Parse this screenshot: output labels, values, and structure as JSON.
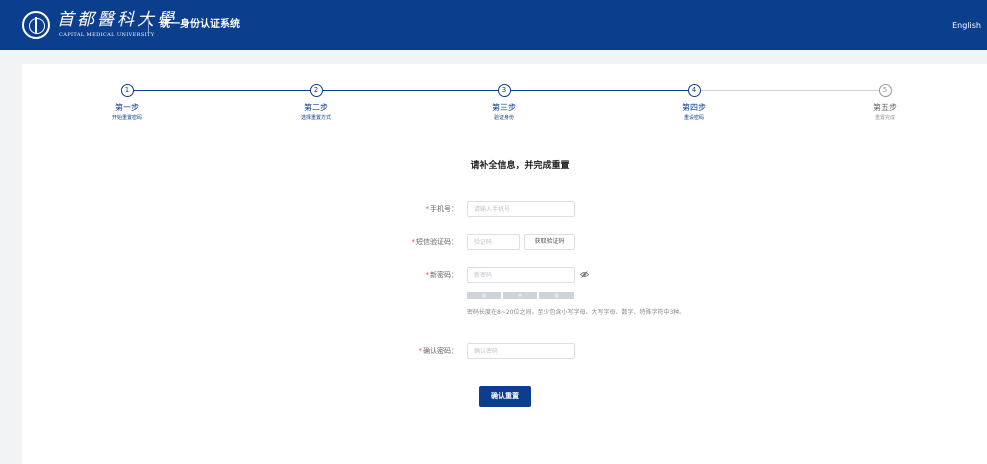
{
  "header": {
    "logo_cn": "首都醫科大學",
    "logo_en": "CAPITAL MEDICAL UNIVERSITY",
    "system_title": "统一身份认证系统",
    "language_link": "English"
  },
  "steps": [
    {
      "number": "1",
      "title": "第一步",
      "desc": "开始重置密码",
      "state": "done"
    },
    {
      "number": "2",
      "title": "第二步",
      "desc": "选择重置方式",
      "state": "done"
    },
    {
      "number": "3",
      "title": "第三步",
      "desc": "验证身份",
      "state": "done"
    },
    {
      "number": "4",
      "title": "第四步",
      "desc": "重设密码",
      "state": "current"
    },
    {
      "number": "5",
      "title": "第五步",
      "desc": "重置完成",
      "state": "todo"
    }
  ],
  "form": {
    "heading": "请补全信息，并完成重置",
    "required_mark": "*",
    "phone_label": "手机号：",
    "phone_placeholder": "请输入手机号",
    "sms_label": "短信验证码：",
    "sms_placeholder": "验证码",
    "sms_button": "获取验证码",
    "new_pwd_label": "新密码：",
    "new_pwd_placeholder": "新密码",
    "strength_labels": [
      "弱",
      "中",
      "强"
    ],
    "pwd_tip": "密码长度在8~20位之间，至少包含小写字母、大写字母、数字、特殊字符中3种。",
    "confirm_label": "确认密码：",
    "confirm_placeholder": "确认密码",
    "submit": "确认重置"
  },
  "colors": {
    "primary": "#0b3e8c",
    "required": "#e84c3d",
    "inactive": "#999999"
  },
  "icons": {
    "logo": "university-emblem-icon",
    "password_visibility": "eye-off-icon"
  }
}
